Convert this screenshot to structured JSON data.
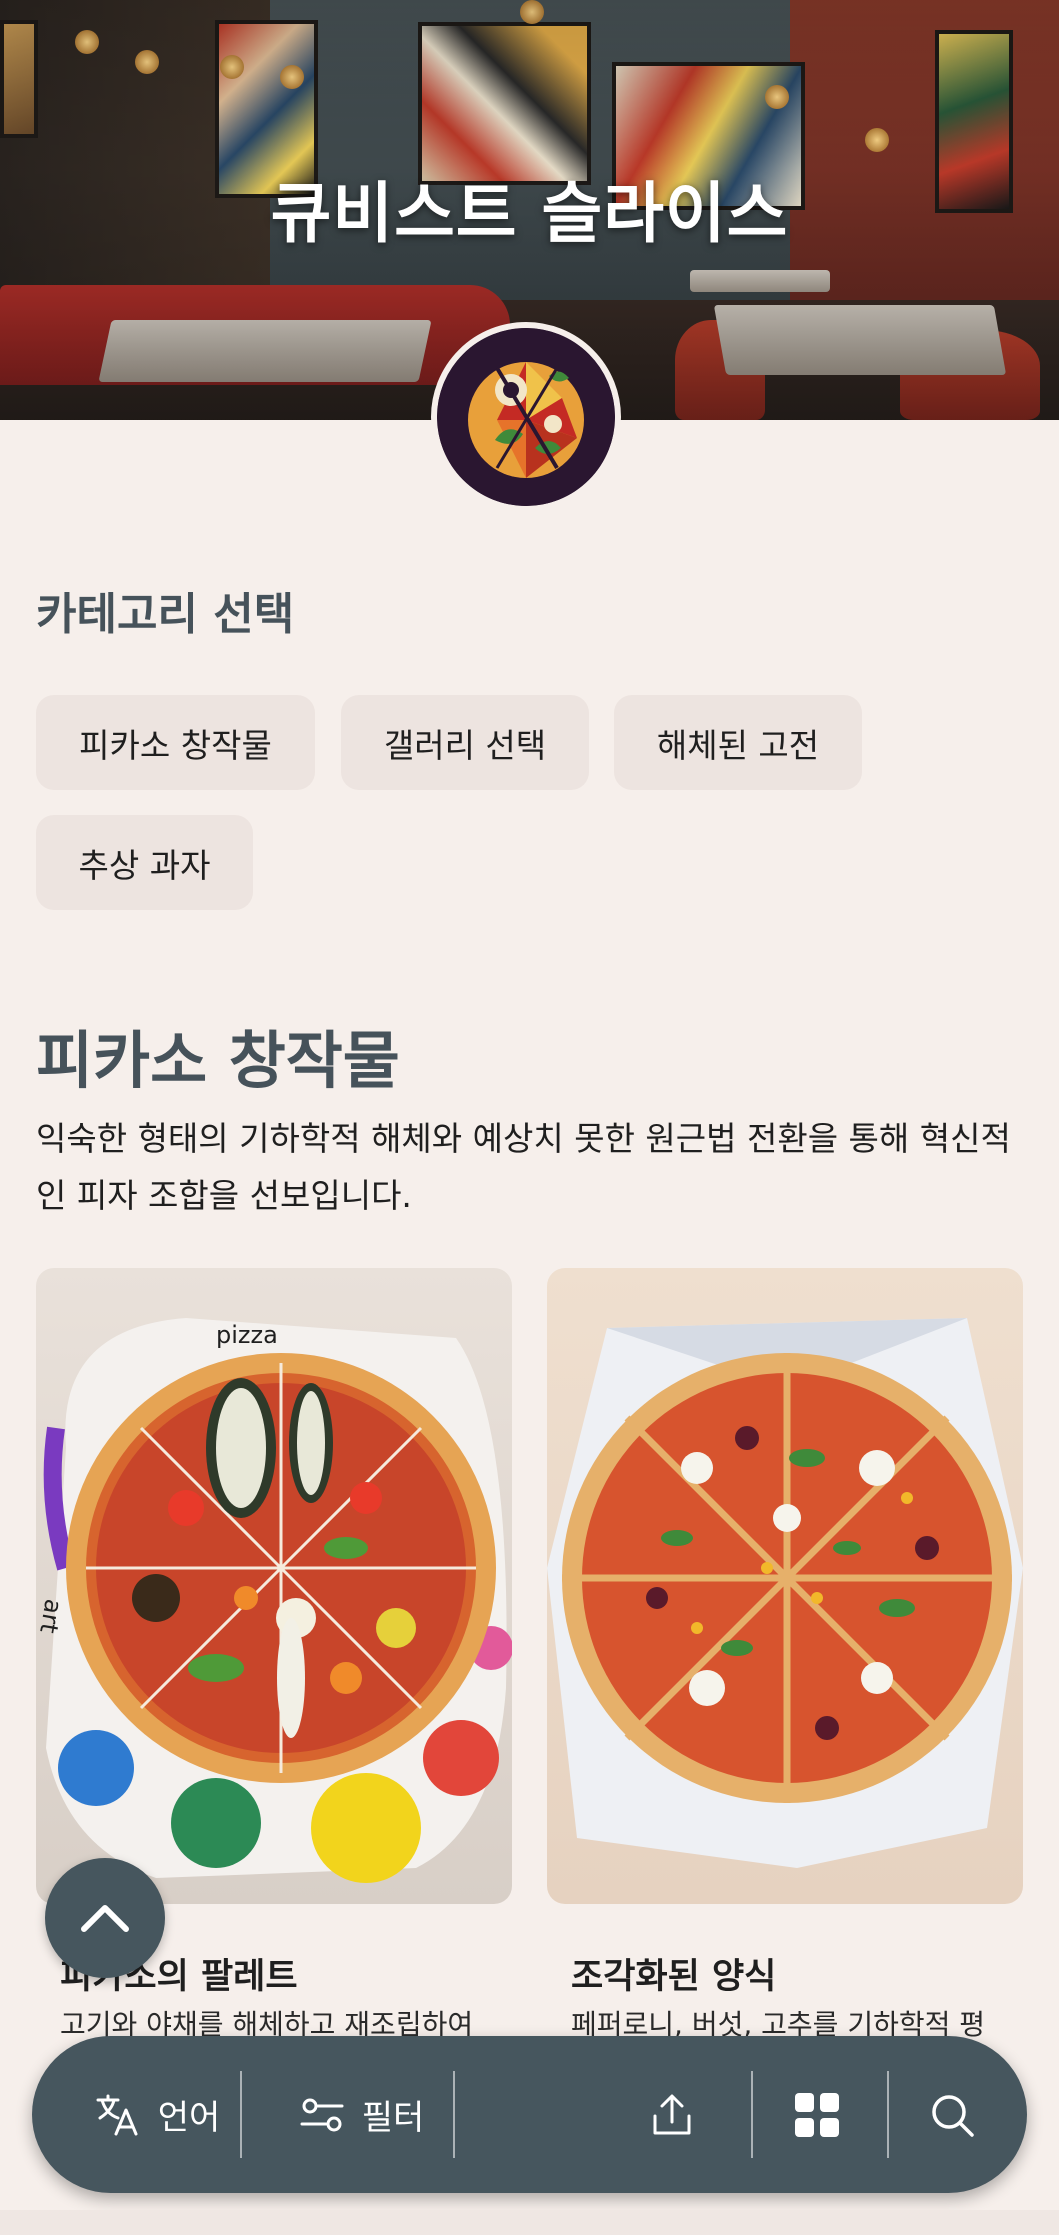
{
  "hero": {
    "title": "큐비스트 슬라이스"
  },
  "category": {
    "heading": "카테고리 선택",
    "chips": [
      {
        "label": "피카소 창작물"
      },
      {
        "label": "갤러리 선택"
      },
      {
        "label": "해체된 고전"
      },
      {
        "label": "추상 과자"
      }
    ]
  },
  "section": {
    "title": "피카소 창작물",
    "description": "익숙한 형태의 기하학적 해체와 예상치 못한 원근법 전환을 통해 혁신적인 피자 조합을 선보입니다."
  },
  "items": [
    {
      "title": "피카소의 팔레트",
      "description": "고기와 야채를 해체하고 재조립하여",
      "image_text_1": "pizza",
      "image_text_2": "art"
    },
    {
      "title": "조각화된 양식",
      "description": "페퍼로니, 버섯, 고추를 기하학적 평"
    }
  ],
  "bottom_bar": {
    "language_label": "언어",
    "filter_label": "필터"
  },
  "icons": {
    "scroll_top": "chevron-up-icon",
    "language": "translate-icon",
    "filter": "filter-toggle-icon",
    "share": "share-icon",
    "grid": "grid-icon",
    "search": "search-icon"
  },
  "colors": {
    "background": "#f6efeb",
    "accent": "#46565e",
    "heading": "#46525a",
    "chip": "#ede4e0"
  }
}
